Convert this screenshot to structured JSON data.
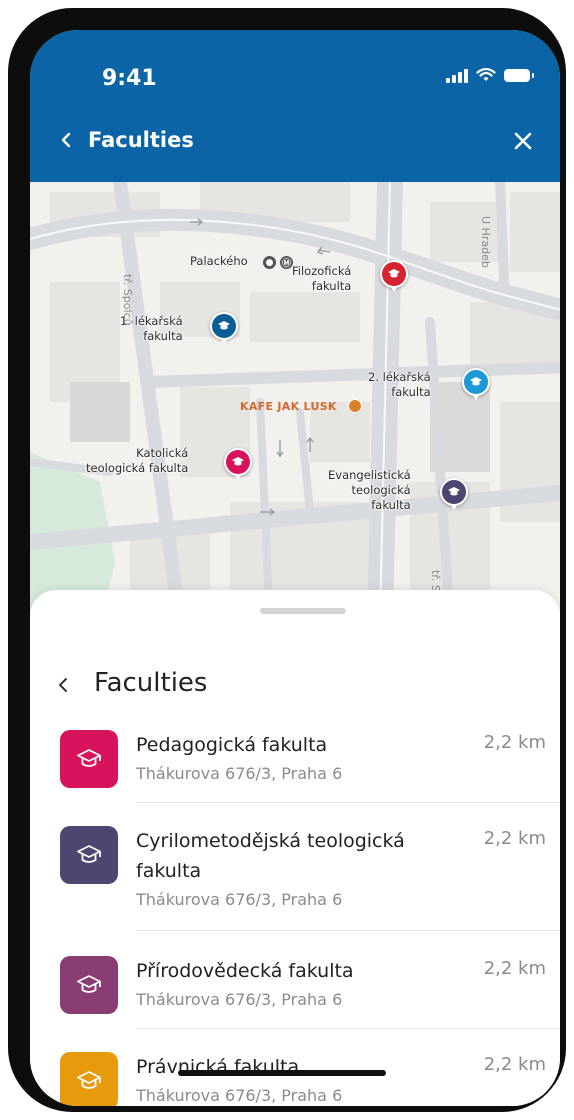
{
  "status_bar": {
    "time": "9:41"
  },
  "header": {
    "title": "Faculties"
  },
  "map": {
    "labels": {
      "palackeho": "Palackého",
      "filozoficka": "Filozofická\nfakulta",
      "lekarska1": "1. lékařská\nfakulta",
      "lekarska2": "2. lékařská\nfakulta",
      "cafe": "KAFE JAK LUSK",
      "katolicka": "Katolická\nteologická fakulta",
      "evangelicka": "Evangelistická\nteologická\nfakulta",
      "street_uhradeb": "U Hradeb",
      "street_spolecnu": "tř. Spolců",
      "street_sv": "tř. Sv"
    },
    "pin_colors": {
      "filozoficka": "#d62331",
      "lekarska1": "#0b5d95",
      "lekarska2": "#1d9ad6",
      "katolicka": "#d8135e",
      "evangelicka": "#4e4670"
    }
  },
  "sheet": {
    "title": "Faculties",
    "items": [
      {
        "name": "Pedagogická fakulta",
        "address": "Thákurova 676/3, Praha 6",
        "distance": "2,2 km",
        "color": "#d8135e"
      },
      {
        "name": "Cyrilometodějská teologická fakulta",
        "address": "Thákurova 676/3, Praha 6",
        "distance": "2,2 km",
        "color": "#4e4670"
      },
      {
        "name": "Přírodovědecká fakulta",
        "address": "Thákurova 676/3, Praha 6",
        "distance": "2,2 km",
        "color": "#8a3d73"
      },
      {
        "name": "Právnická fakulta",
        "address": "Thákurova 676/3, Praha 6",
        "distance": "2,2 km",
        "color": "#e89a0d"
      }
    ]
  }
}
